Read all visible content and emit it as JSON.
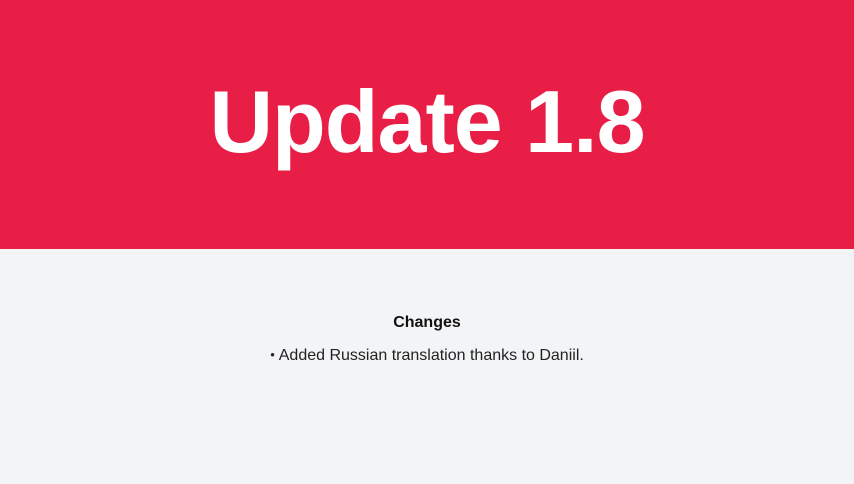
{
  "hero": {
    "title": "Update 1.8",
    "background_color": "#e91e47"
  },
  "changes": {
    "heading": "Changes",
    "items": [
      {
        "bullet": "•",
        "text": "Added Russian translation thanks to Daniil."
      }
    ]
  }
}
